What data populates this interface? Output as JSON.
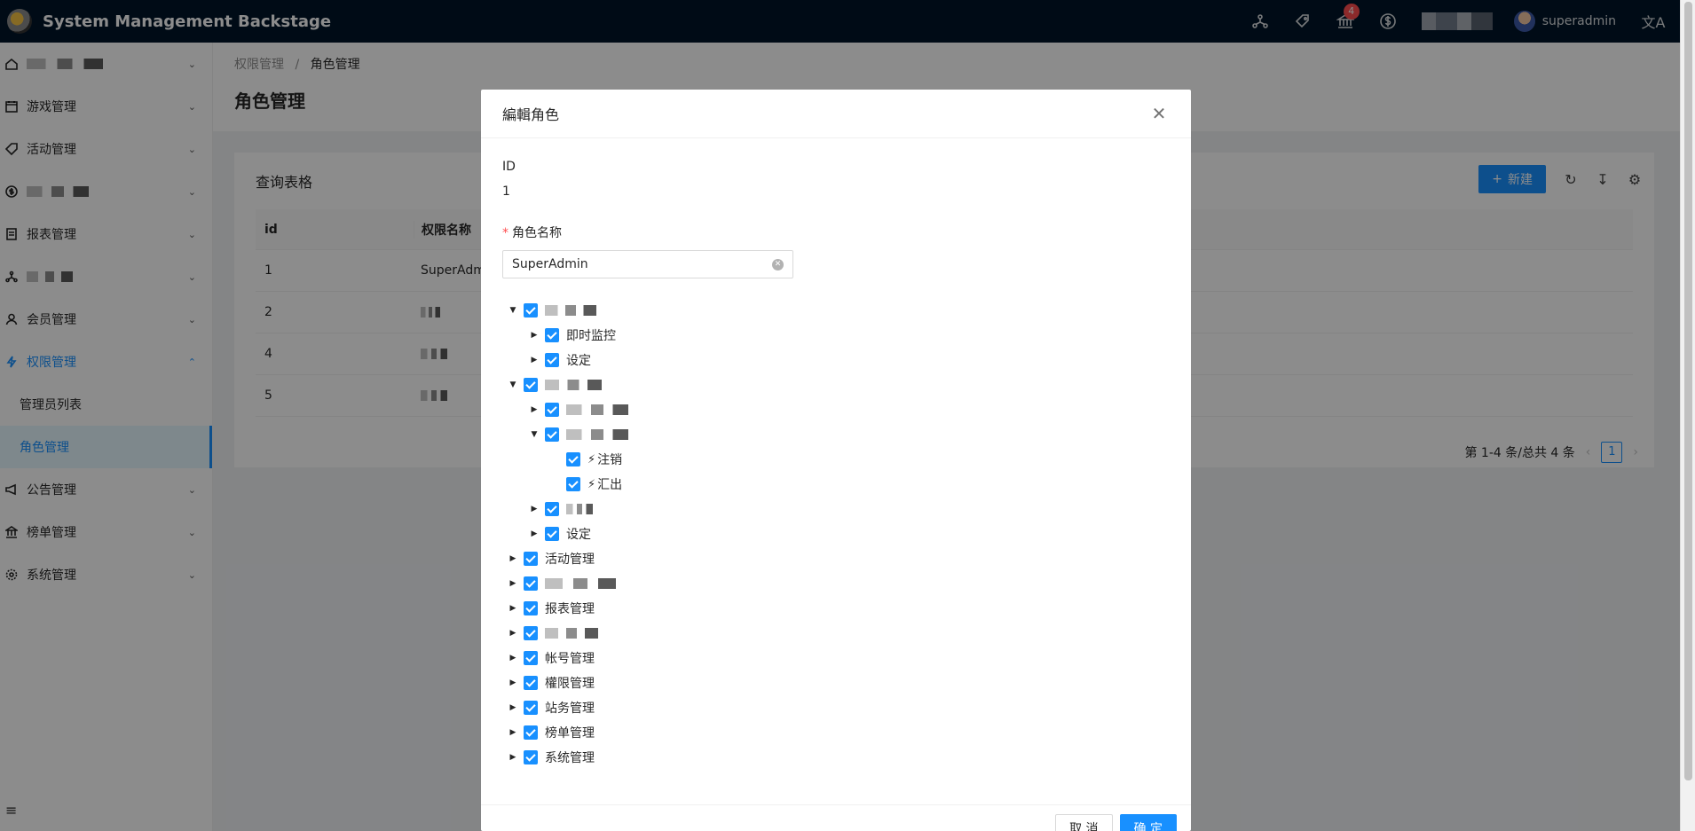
{
  "header": {
    "title": "System Management Backstage",
    "notification_count": "4",
    "user_name": "superadmin",
    "icons": [
      "cluster-icon",
      "tag-icon",
      "bank-icon",
      "dollar-icon",
      "translation-icon"
    ]
  },
  "sidebar": {
    "items": [
      {
        "label": "",
        "icon": "home-icon"
      },
      {
        "label": "游戏管理",
        "icon": "calendar-icon"
      },
      {
        "label": "活动管理",
        "icon": "tag-icon"
      },
      {
        "label": "",
        "icon": "dollar-icon"
      },
      {
        "label": "报表管理",
        "icon": "report-icon"
      },
      {
        "label": "",
        "icon": "cluster-icon"
      },
      {
        "label": "会员管理",
        "icon": "user-icon"
      },
      {
        "label": "权限管理",
        "icon": "thunder-icon"
      },
      {
        "label": "公告管理",
        "icon": "notification-icon"
      },
      {
        "label": "榜单管理",
        "icon": "bank-icon"
      },
      {
        "label": "系统管理",
        "icon": "setting-icon"
      }
    ],
    "sub_items": [
      {
        "label": "管理员列表"
      },
      {
        "label": "角色管理"
      }
    ]
  },
  "breadcrumb": {
    "parent": "权限管理",
    "current": "角色管理"
  },
  "page": {
    "title": "角色管理"
  },
  "table_card": {
    "title": "查询表格",
    "new_button": "新建",
    "columns": [
      "id",
      "权限名称"
    ],
    "rows": [
      {
        "id": "1",
        "name": "SuperAdmi"
      },
      {
        "id": "2",
        "name": ""
      },
      {
        "id": "4",
        "name": ""
      },
      {
        "id": "5",
        "name": ""
      }
    ],
    "pagination": {
      "summary": "第 1-4 条/总共 4 条",
      "current_page": "1"
    }
  },
  "modal": {
    "title": "編輯角色",
    "id_label": "ID",
    "id_value": "1",
    "role_name_label": "角色名称",
    "role_name_value": "SuperAdmin",
    "tree": [
      {
        "label": "",
        "level": 0,
        "expanded": true
      },
      {
        "label": "即时监控",
        "level": 1,
        "expanded": false
      },
      {
        "label": "设定",
        "level": 1,
        "expanded": false
      },
      {
        "label": "",
        "level": 0,
        "expanded": true
      },
      {
        "label": "",
        "level": 1,
        "expanded": false
      },
      {
        "label": "",
        "level": 1,
        "expanded": true
      },
      {
        "label": "注销",
        "level": 2,
        "leaf": true,
        "action": true
      },
      {
        "label": "汇出",
        "level": 2,
        "leaf": true,
        "action": true
      },
      {
        "label": "",
        "level": 1,
        "expanded": false
      },
      {
        "label": "设定",
        "level": 1,
        "expanded": false
      },
      {
        "label": "活动管理",
        "level": 0,
        "expanded": false
      },
      {
        "label": "",
        "level": 0,
        "expanded": false
      },
      {
        "label": "报表管理",
        "level": 0,
        "expanded": false
      },
      {
        "label": "",
        "level": 0,
        "expanded": false
      },
      {
        "label": "帐号管理",
        "level": 0,
        "expanded": false
      },
      {
        "label": "權限管理",
        "level": 0,
        "expanded": false
      },
      {
        "label": "站务管理",
        "level": 0,
        "expanded": false
      },
      {
        "label": "榜单管理",
        "level": 0,
        "expanded": false
      },
      {
        "label": "系统管理",
        "level": 0,
        "expanded": false
      }
    ],
    "cancel_button": "取 消",
    "ok_button": "确 定"
  },
  "colors": {
    "primary": "#1890ff",
    "header_bg": "#001529",
    "badge": "#ff4d4f"
  }
}
